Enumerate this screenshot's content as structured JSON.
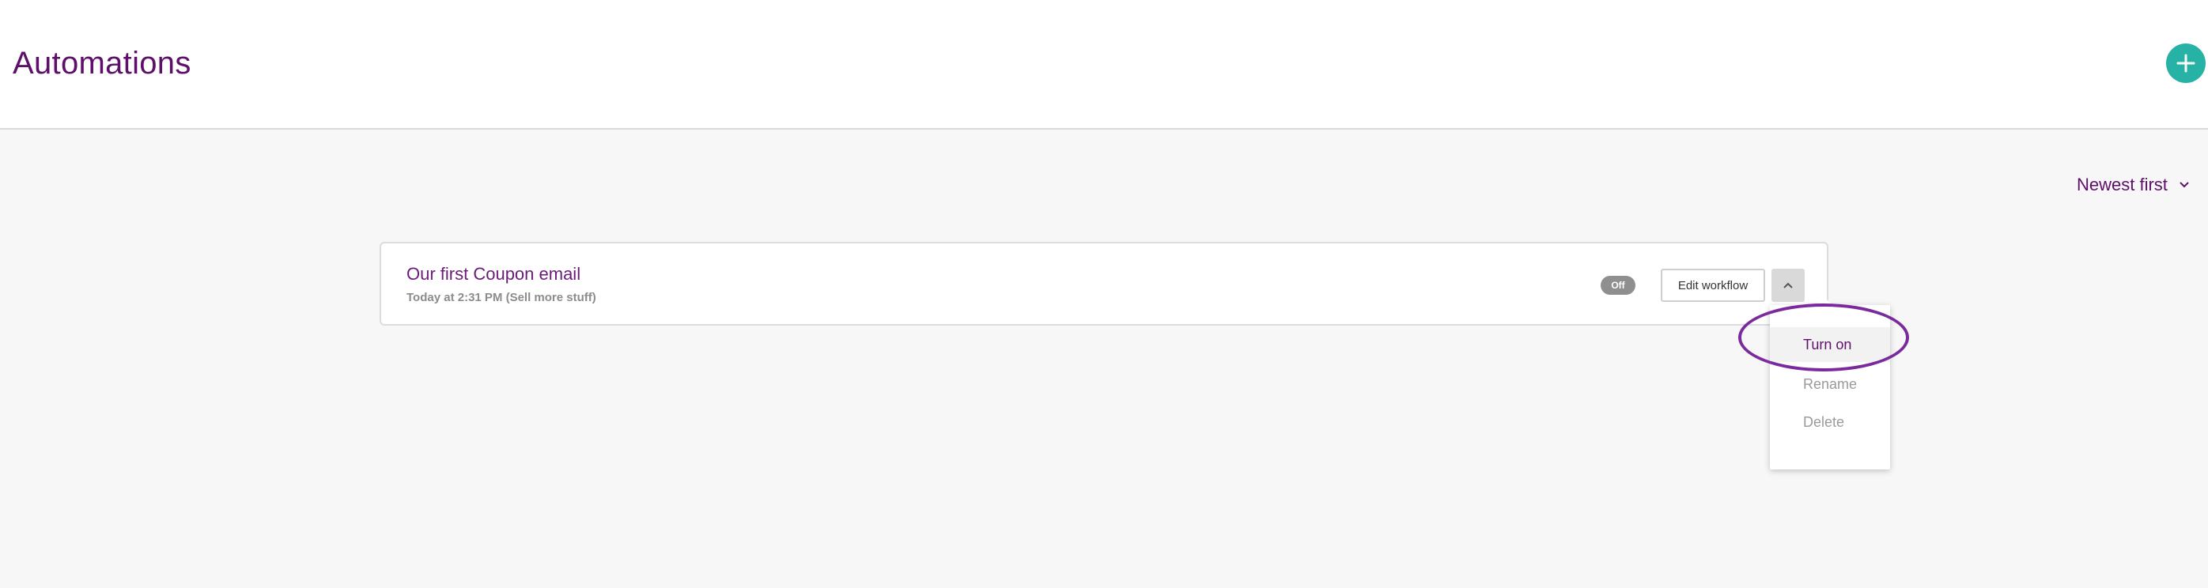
{
  "header": {
    "title": "Automations",
    "add_button_icon": "plus-icon"
  },
  "sort": {
    "label": "Newest first",
    "icon": "chevron-down-icon"
  },
  "automations": [
    {
      "title": "Our first Coupon email",
      "subtitle": "Today at 2:31 PM (Sell more stuff)",
      "status": "Off",
      "edit_label": "Edit workflow",
      "menu_toggle_icon": "chevron-up-icon"
    }
  ],
  "menu": {
    "items": [
      {
        "label": "Turn on"
      },
      {
        "label": "Rename"
      },
      {
        "label": "Delete"
      }
    ]
  },
  "colors": {
    "brand_purple": "#5e0f69",
    "accent_teal": "#26b3a6",
    "highlight_purple": "#7b2a9e",
    "status_off": "#8f8f8f",
    "muted_text": "#9a9a9a"
  }
}
